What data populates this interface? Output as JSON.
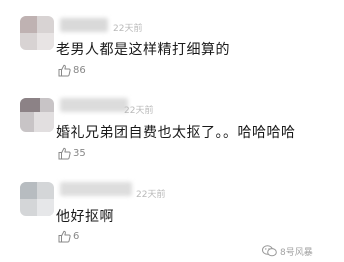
{
  "comments": [
    {
      "time": "22天前",
      "text": "老男人都是这样精打细算的",
      "likes": "86"
    },
    {
      "time": "22天前",
      "text": "婚礼兄弟团自费也太抠了。。哈哈哈哈",
      "likes": "35"
    },
    {
      "time": "22天前",
      "text": "他好抠啊",
      "likes": "6"
    }
  ],
  "watermark": {
    "text": "8号风暴",
    "icon": "wechat-icon"
  },
  "colors": {
    "text": "#1a1a1a",
    "time": "#b9b9b9",
    "likes": "#888888"
  }
}
